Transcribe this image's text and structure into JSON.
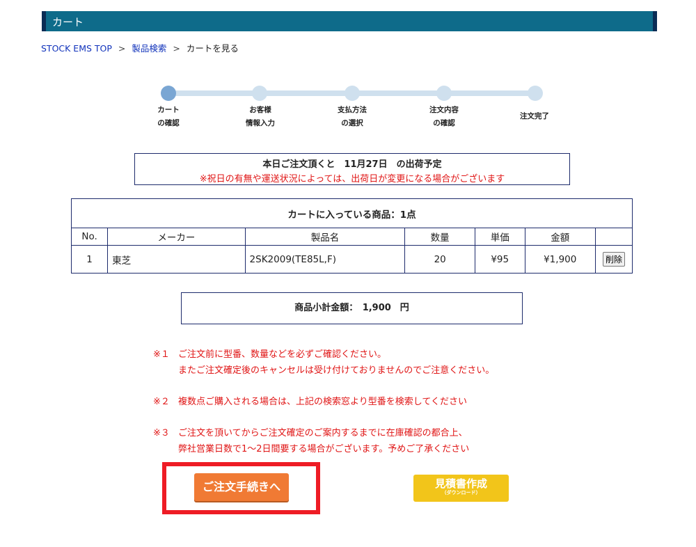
{
  "header": {
    "title": "カート"
  },
  "breadcrumb": {
    "home": "STOCK EMS TOP",
    "sep": ">",
    "search": "製品検索",
    "current": "カートを見る"
  },
  "steps": [
    {
      "l1": "カート",
      "l2": "の確認"
    },
    {
      "l1": "お客様",
      "l2": "情報入力"
    },
    {
      "l1": "支払方法",
      "l2": "の選択"
    },
    {
      "l1": "注文内容",
      "l2": "の確認"
    },
    {
      "l1": "注文完了",
      "l2": ""
    }
  ],
  "notice": {
    "line1": "本日ご注文頂くと　11月27日　の出荷予定",
    "line2": "※祝日の有無や運送状況によっては、出荷日が変更になる場合がございます"
  },
  "cart": {
    "title": "カートに入っている商品：1点",
    "columns": [
      "No.",
      "メーカー",
      "製品名",
      "数量",
      "単価",
      "金額",
      ""
    ],
    "rows": [
      {
        "no": "1",
        "maker": "東芝",
        "product": "2SK2009(TE85L,F)",
        "qty": "20",
        "unit_price": "¥95",
        "amount": "¥1,900",
        "delete_label": "削除"
      }
    ]
  },
  "subtotal": {
    "text": "商品小計金額：　1,900　円"
  },
  "notes": [
    {
      "mark": "※１",
      "lines": [
        "ご注文前に型番、数量などを必ずご確認ください。",
        "またご注文確定後のキャンセルは受け付けておりませんのでご注意ください。"
      ]
    },
    {
      "mark": "※２",
      "lines": [
        "複数点ご購入される場合は、上記の検索窓より型番を検索してください"
      ]
    },
    {
      "mark": "※３",
      "lines": [
        "ご注文を頂いてからご注文確定のご案内するまでに在庫確認の都合上、",
        "弊社営業日数で1～2日間要する場合がございます。予めご了承ください"
      ]
    }
  ],
  "buttons": {
    "order": "ご注文手続きへ",
    "quote_main": "見積書作成",
    "quote_sub": "（ダウンロード）"
  },
  "colors": {
    "header": "#0e6b8a",
    "order_button": "#f07a34",
    "quote_button": "#f2c51a",
    "highlight": "#ee1c25",
    "note_text": "#e01515"
  }
}
